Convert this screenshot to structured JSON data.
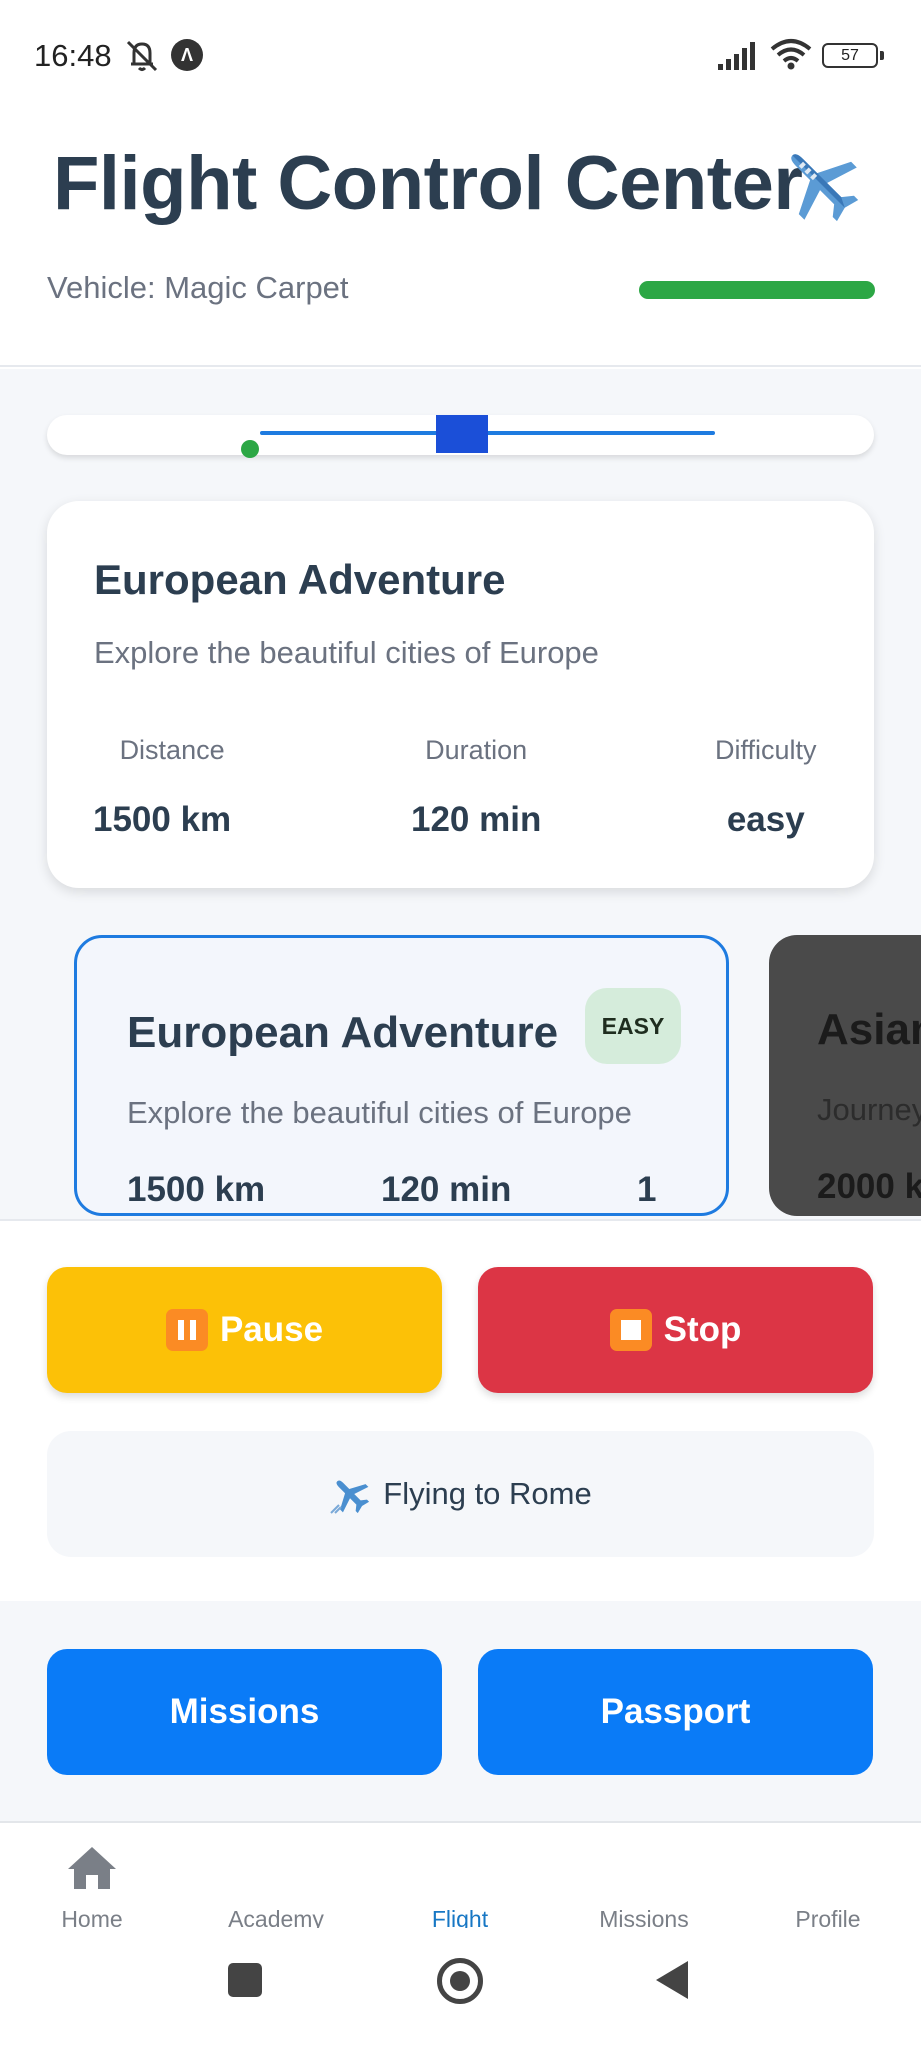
{
  "status_bar": {
    "time": "16:48",
    "app_icon_letter": "Λ",
    "battery": "57"
  },
  "header": {
    "title": "Flight Control Center",
    "title_icon": "airplane-icon",
    "vehicle": "Vehicle: Magic Carpet",
    "vehicle_bar_color": "#2ca745"
  },
  "route": {
    "start_color": "#2ca745",
    "line_color": "#1e7be0",
    "marker_color": "#1b4fd8"
  },
  "current_mission": {
    "title": "European Adventure",
    "description": "Explore the beautiful cities of Europe",
    "stats": [
      {
        "label": "Distance",
        "value": "1500 km"
      },
      {
        "label": "Duration",
        "value": "120 min"
      },
      {
        "label": "Difficulty",
        "value": "easy"
      }
    ]
  },
  "mission_cards": [
    {
      "title": "European Adventure",
      "badge": "EASY",
      "description": "Explore the beautiful cities of Europe",
      "distance": "1500 km",
      "duration": "120 min",
      "count": "1"
    },
    {
      "title": "Asian",
      "description": "Journey",
      "distance": "2000 k"
    }
  ],
  "controls": {
    "pause_label": "Pause",
    "stop_label": "Stop",
    "status_text": "Flying to Rome",
    "status_icon": "flying-plane-icon",
    "pause_color": "#fcc107",
    "stop_color": "#dc3545"
  },
  "nav_buttons": {
    "missions": "Missions",
    "passport": "Passport",
    "color": "#0a7bf7"
  },
  "tabs": [
    {
      "label": "Home",
      "icon": "home-icon"
    },
    {
      "label": "Academy"
    },
    {
      "label": "Flight",
      "active": true
    },
    {
      "label": "Missions"
    },
    {
      "label": "Profile"
    }
  ]
}
